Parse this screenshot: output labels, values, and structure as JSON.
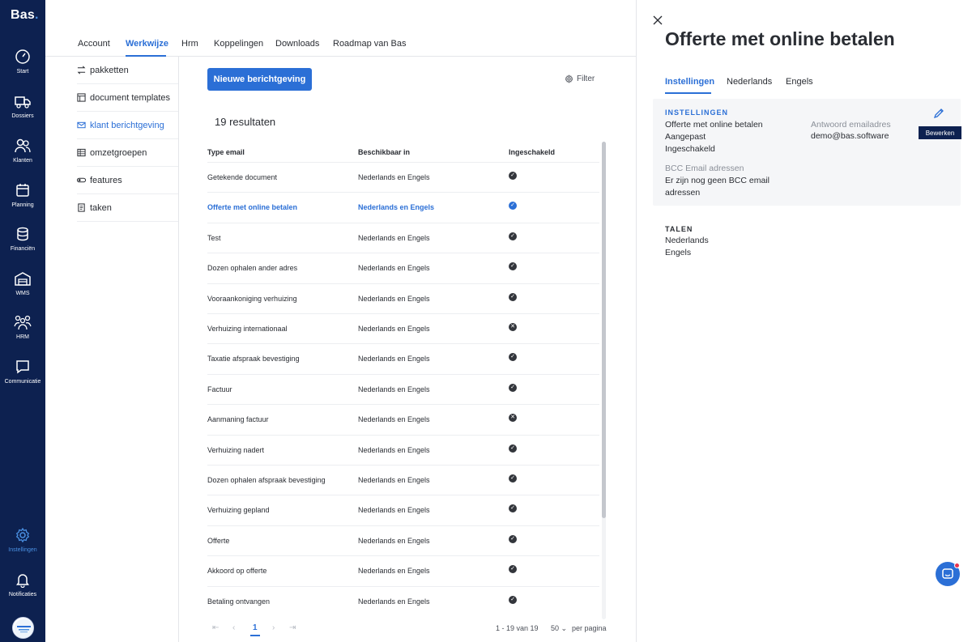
{
  "app": {
    "logo": "Bas",
    "logo_dot": "."
  },
  "leftnav": {
    "items": [
      {
        "label": "Start",
        "icon": "speedometer-icon"
      },
      {
        "label": "Dossiers",
        "icon": "truck-icon"
      },
      {
        "label": "Klanten",
        "icon": "users-icon"
      },
      {
        "label": "Planning",
        "icon": "calendar-icon"
      },
      {
        "label": "Financiën",
        "icon": "coins-icon"
      },
      {
        "label": "WMS",
        "icon": "warehouse-icon"
      },
      {
        "label": "HRM",
        "icon": "team-icon"
      },
      {
        "label": "Communicatie",
        "icon": "chat-icon"
      },
      {
        "label": "Instellingen",
        "icon": "gear-icon"
      },
      {
        "label": "Notificaties",
        "icon": "bell-icon"
      }
    ]
  },
  "topnav": {
    "tabs": [
      "Account",
      "Werkwijze",
      "Hrm",
      "Koppelingen",
      "Downloads",
      "Roadmap van Bas"
    ],
    "active": "Werkwijze"
  },
  "subnav": {
    "items": [
      {
        "label": "pakketten",
        "icon": "swap-icon"
      },
      {
        "label": "document templates",
        "icon": "layout-icon"
      },
      {
        "label": "klant berichtgeving",
        "icon": "mail-icon"
      },
      {
        "label": "omzetgroepen",
        "icon": "grid-icon"
      },
      {
        "label": "features",
        "icon": "toggle-icon"
      },
      {
        "label": "taken",
        "icon": "document-icon"
      }
    ],
    "active": "klant berichtgeving"
  },
  "main": {
    "new_button": "Nieuwe berichtgeving",
    "filter": "Filter",
    "results": "19 resultaten",
    "columns": [
      "Type email",
      "Beschikbaar in",
      "Ingeschakeld"
    ],
    "rows": [
      {
        "type": "Getekende document",
        "available": "Nederlands en Engels",
        "enabled": true
      },
      {
        "type": "Offerte met online betalen",
        "available": "Nederlands en Engels",
        "enabled": true,
        "active": true
      },
      {
        "type": "Test",
        "available": "Nederlands en Engels",
        "enabled": true
      },
      {
        "type": "Dozen ophalen ander adres",
        "available": "Nederlands en Engels",
        "enabled": true
      },
      {
        "type": "Vooraankoniging verhuizing",
        "available": "Nederlands en Engels",
        "enabled": true
      },
      {
        "type": "Verhuizing internationaal",
        "available": "Nederlands en Engels",
        "enabled": false
      },
      {
        "type": "Taxatie afspraak bevestiging",
        "available": "Nederlands en Engels",
        "enabled": true
      },
      {
        "type": "Factuur",
        "available": "Nederlands en Engels",
        "enabled": true
      },
      {
        "type": "Aanmaning factuur",
        "available": "Nederlands en Engels",
        "enabled": false
      },
      {
        "type": "Verhuizing nadert",
        "available": "Nederlands en Engels",
        "enabled": true
      },
      {
        "type": "Dozen ophalen afspraak bevestiging",
        "available": "Nederlands en Engels",
        "enabled": true
      },
      {
        "type": "Verhuizing gepland",
        "available": "Nederlands en Engels",
        "enabled": true
      },
      {
        "type": "Offerte",
        "available": "Nederlands en Engels",
        "enabled": true
      },
      {
        "type": "Akkoord op offerte",
        "available": "Nederlands en Engels",
        "enabled": true
      },
      {
        "type": "Betaling ontvangen",
        "available": "Nederlands en Engels",
        "enabled": true
      }
    ],
    "pager": {
      "current": "1",
      "range": "1 - 19 van 19",
      "per_page": "50",
      "per_page_label": "per pagina"
    }
  },
  "panel": {
    "title": "Offerte met online betalen",
    "tabs": [
      "Instellingen",
      "Nederlands",
      "Engels"
    ],
    "settings": {
      "heading": "INSTELLINGEN",
      "name": "Offerte met online betalen",
      "status1": "Aangepast",
      "status2": "Ingeschakeld",
      "reply_label": "Antwoord emailadres",
      "reply_value": "demo@bas.software",
      "bcc_label": "BCC Email adressen",
      "bcc_value_line1": "Er zijn nog geen BCC email",
      "bcc_value_line2": "adressen",
      "edit_button": "Bewerken"
    },
    "languages": {
      "heading": "TALEN",
      "items": [
        "Nederlands",
        "Engels"
      ]
    }
  },
  "colors": {
    "nav_bg": "#0d2150",
    "accent": "#2b6fd6"
  }
}
